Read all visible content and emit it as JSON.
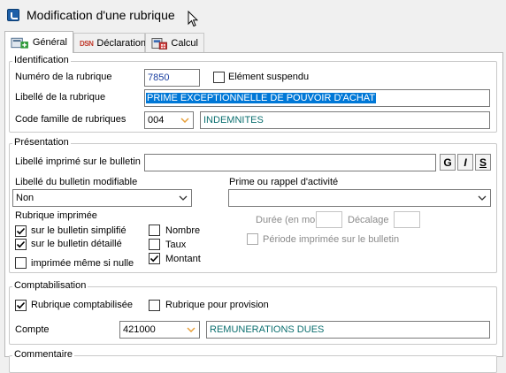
{
  "window": {
    "title": "Modification d'une rubrique"
  },
  "tabs": [
    {
      "label": "Général",
      "icon": "general-icon",
      "active": true
    },
    {
      "label": "Déclaration",
      "icon": "dsn-declaration-icon",
      "active": false
    },
    {
      "label": "Calcul",
      "icon": "calculator-icon",
      "active": false
    }
  ],
  "identification": {
    "legend": "Identification",
    "numero_label": "Numéro de la rubrique",
    "numero_value": "7850",
    "suspendu_label": "Elément suspendu",
    "suspendu_checked": false,
    "libelle_label": "Libellé de la rubrique",
    "libelle_value": "PRIME EXCEPTIONNELLE DE POUVOIR D'ACHAT",
    "code_famille_label": "Code famille de rubriques",
    "code_famille_value": "004",
    "famille_name": "INDEMNITES"
  },
  "presentation": {
    "legend": "Présentation",
    "libelle_imprime_label": "Libellé imprimé sur le bulletin",
    "libelle_imprime_value": "",
    "format_buttons": [
      "G",
      "I",
      "S"
    ],
    "libelle_modifiable_label": "Libellé du bulletin modifiable",
    "libelle_modifiable_value": "Non",
    "prime_rappel_label": "Prime ou rappel d'activité",
    "prime_rappel_value": "",
    "rubrique_imprimee_label": "Rubrique imprimée",
    "print_options": [
      {
        "label": "sur le bulletin simplifié",
        "checked": true
      },
      {
        "label": "sur le bulletin détaillé",
        "checked": true
      },
      {
        "label": "imprimée même si nulle",
        "checked": false
      }
    ],
    "print_columns": [
      {
        "label": "Nombre",
        "checked": false
      },
      {
        "label": "Taux",
        "checked": false
      },
      {
        "label": "Montant",
        "checked": true
      }
    ],
    "duree_label": "Durée (en mois)",
    "decalage_label": "Décalage",
    "periode_label": "Période imprimée sur le bulletin",
    "periode_checked": false
  },
  "comptabilisation": {
    "legend": "Comptabilisation",
    "comptabilisee_label": "Rubrique comptabilisée",
    "comptabilisee_checked": true,
    "provision_label": "Rubrique pour provision",
    "provision_checked": false,
    "compte_label": "Compte",
    "compte_value": "421000",
    "compte_name": "REMUNERATIONS DUES"
  },
  "next_section_partial": "Commentaire",
  "colors": {
    "accent_blue": "#1a3fa0",
    "teal_text": "#0b6f6f",
    "selection": "#0078d7",
    "dropdown_orange": "#e8a03a"
  }
}
